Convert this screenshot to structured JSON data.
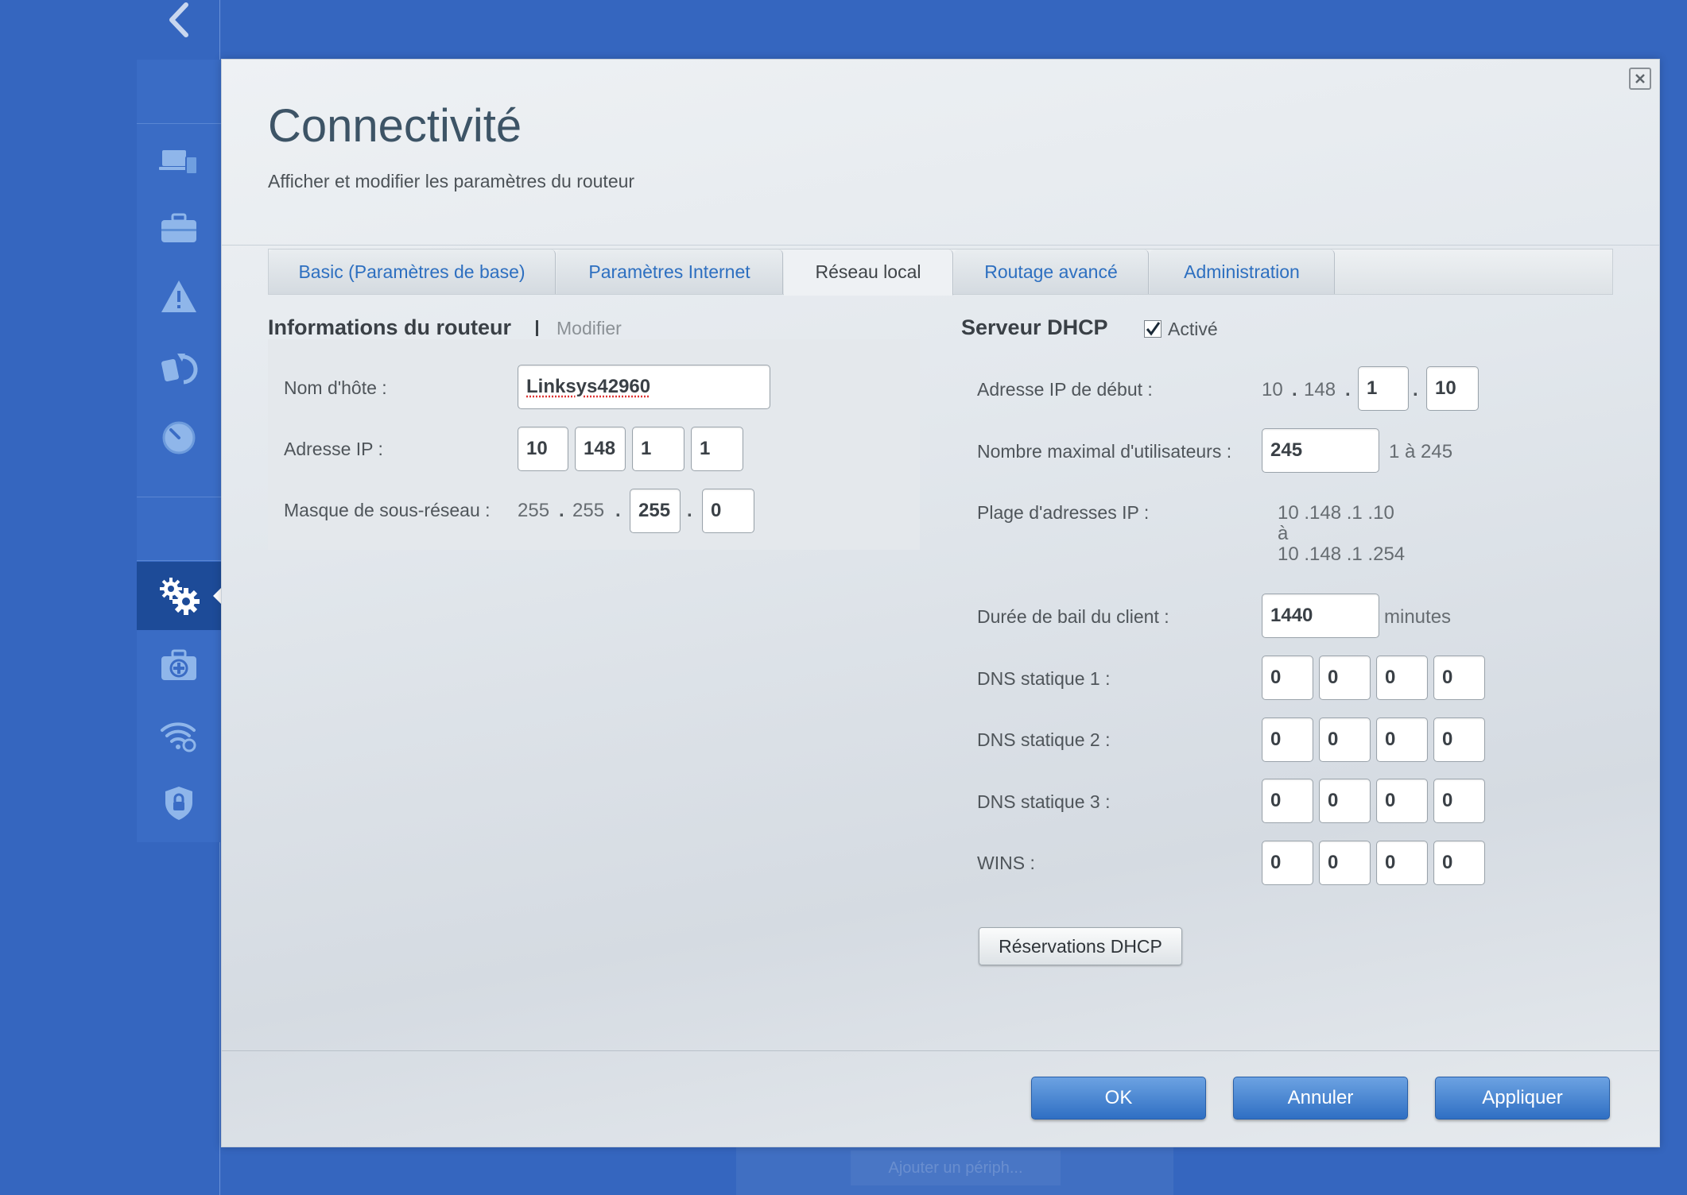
{
  "dialog": {
    "title": "Connectivité",
    "subtitle": "Afficher et modifier les paramètres du routeur"
  },
  "sidebar": {
    "items": [
      {
        "icon": "devices-icon"
      },
      {
        "icon": "toolbox-icon"
      },
      {
        "icon": "warning-icon"
      },
      {
        "icon": "media-icon"
      },
      {
        "icon": "speed-icon"
      },
      {
        "icon": "gear-icon",
        "active": true
      },
      {
        "icon": "troubleshoot-icon"
      },
      {
        "icon": "wireless-icon"
      },
      {
        "icon": "security-icon"
      }
    ]
  },
  "tabs": [
    {
      "label": "Basic (Paramètres de base)"
    },
    {
      "label": "Paramètres Internet"
    },
    {
      "label": "Réseau local",
      "active": true
    },
    {
      "label": "Routage avancé"
    },
    {
      "label": "Administration"
    }
  ],
  "router_info": {
    "title": "Informations du routeur",
    "separator": "I",
    "edit_link": "Modifier",
    "hostname_label": "Nom d'hôte :",
    "hostname_value": "Linksys42960",
    "ip_label": "Adresse IP :",
    "ip": [
      "10",
      "148",
      "1",
      "1"
    ],
    "mask_label": "Masque de sous-réseau :",
    "mask_fixed": [
      "255",
      "255"
    ],
    "mask_editable": [
      "255",
      "0"
    ]
  },
  "dhcp": {
    "title": "Serveur DHCP",
    "enabled_label": "Activé",
    "enabled": true,
    "start_ip_label": "Adresse IP de début :",
    "start_ip_fixed": [
      "10",
      "148"
    ],
    "start_ip_editable": [
      "1",
      "10"
    ],
    "max_users_label": "Nombre maximal d'utilisateurs :",
    "max_users_value": "245",
    "max_users_range": "1 à 245",
    "range_label": "Plage d'adresses IP :",
    "range_start": "10 .148 .1 .10",
    "range_to": "à",
    "range_end": "10 .148 .1 .254",
    "lease_label": "Durée de bail du client :",
    "lease_value": "1440",
    "lease_unit": "minutes",
    "dns1_label": "DNS statique 1 :",
    "dns1": [
      "0",
      "0",
      "0",
      "0"
    ],
    "dns2_label": "DNS statique 2 :",
    "dns2": [
      "0",
      "0",
      "0",
      "0"
    ],
    "dns3_label": "DNS statique 3 :",
    "dns3": [
      "0",
      "0",
      "0",
      "0"
    ],
    "wins_label": "WINS :",
    "wins": [
      "0",
      "0",
      "0",
      "0"
    ],
    "reservations_button": "Réservations DHCP"
  },
  "footer": {
    "ok": "OK",
    "cancel": "Annuler",
    "apply": "Appliquer"
  },
  "background": {
    "hidden_button": "Ajouter un périph..."
  },
  "colors": {
    "page_background": "#3566bf",
    "sidebar_active": "#1d4b98",
    "accent_blue": "#2d6fc0",
    "button_blue": "#2f6fc3"
  }
}
